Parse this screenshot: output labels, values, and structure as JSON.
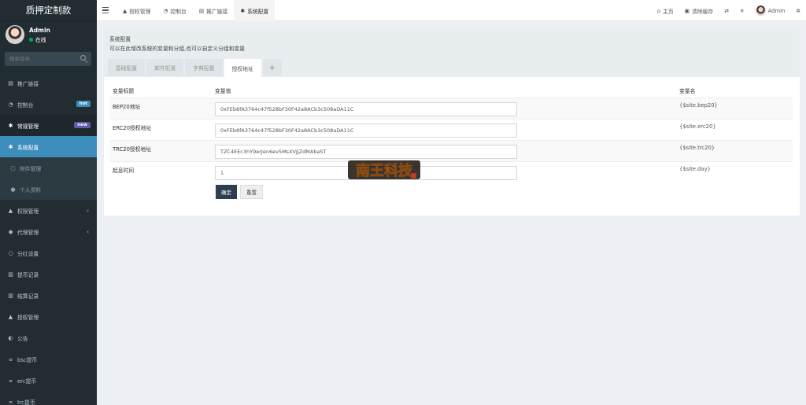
{
  "app": {
    "title": "质押定制款"
  },
  "user": {
    "name": "Admin",
    "status": "在线"
  },
  "search": {
    "placeholder": "搜索菜单"
  },
  "sidebar": {
    "items": [
      {
        "label": "推广链接",
        "icon": "file-icon"
      },
      {
        "label": "控制台",
        "icon": "dashboard-icon",
        "badge": "hot"
      },
      {
        "label": "常规管理",
        "icon": "cog-icon",
        "badge": "new"
      },
      {
        "label": "系统配置",
        "icon": "cog-icon"
      },
      {
        "label": "附件管理",
        "icon": "file-icon"
      },
      {
        "label": "个人资料",
        "icon": "user-icon"
      },
      {
        "label": "权限管理",
        "icon": "users-icon"
      },
      {
        "label": "代理管理",
        "icon": "user-circle-icon"
      },
      {
        "label": "分红设置",
        "icon": "circle-icon"
      },
      {
        "label": "提币记录",
        "icon": "bank-icon"
      },
      {
        "label": "结算记录",
        "icon": "bank-icon"
      },
      {
        "label": "授权管理",
        "icon": "users-icon"
      },
      {
        "label": "公告",
        "icon": "half-circle-icon"
      },
      {
        "label": "bsc提币",
        "icon": "bicycle-icon"
      },
      {
        "label": "erc提币",
        "icon": "bicycle-icon"
      },
      {
        "label": "trc提币",
        "icon": "bicycle-icon"
      }
    ]
  },
  "topnav": {
    "tabs": [
      {
        "label": "授权管理",
        "icon": "users-icon"
      },
      {
        "label": "控制台",
        "icon": "dashboard-icon"
      },
      {
        "label": "推广链接",
        "icon": "file-icon"
      },
      {
        "label": "系统配置",
        "icon": "cog-icon"
      }
    ],
    "home": "主页",
    "clear_cache": "清除缓存",
    "admin": "Admin"
  },
  "panel": {
    "title": "系统配置",
    "description": "可以在此增改系统的变量和分组,也可以自定义分组和变量",
    "tabs": [
      "基础配置",
      "邮件配置",
      "字典配置",
      "授权地址"
    ],
    "plus": "+"
  },
  "table": {
    "headers": [
      "变量标题",
      "变量值",
      "变量名"
    ],
    "rows": [
      {
        "title": "BEP20地址",
        "value": "0xFEb8fA3764c47f528bF30F42a8ACb3c508aDA11C",
        "name": "{$site.bep20}"
      },
      {
        "title": "ERC20授权地址",
        "value": "0xFEb8fA3764c47f528bF30F42a8ACb3c508aDA11C",
        "name": "{$site.erc20}"
      },
      {
        "title": "TRC20授权地址",
        "value": "TZC4EEc3hY9erJen6ev5MsXVJjZdMAbaST",
        "name": "{$site.trc20}"
      },
      {
        "title": "起息时间",
        "value": "1",
        "name": "{$site.day}"
      }
    ]
  },
  "actions": {
    "ok": "确定",
    "reset": "重置"
  },
  "watermark": {
    "text": "南王科技"
  },
  "colors": {
    "sidebar_bg": "#222d32",
    "active_blue": "#3c8dbc",
    "ok_button": "#2c3e50"
  }
}
